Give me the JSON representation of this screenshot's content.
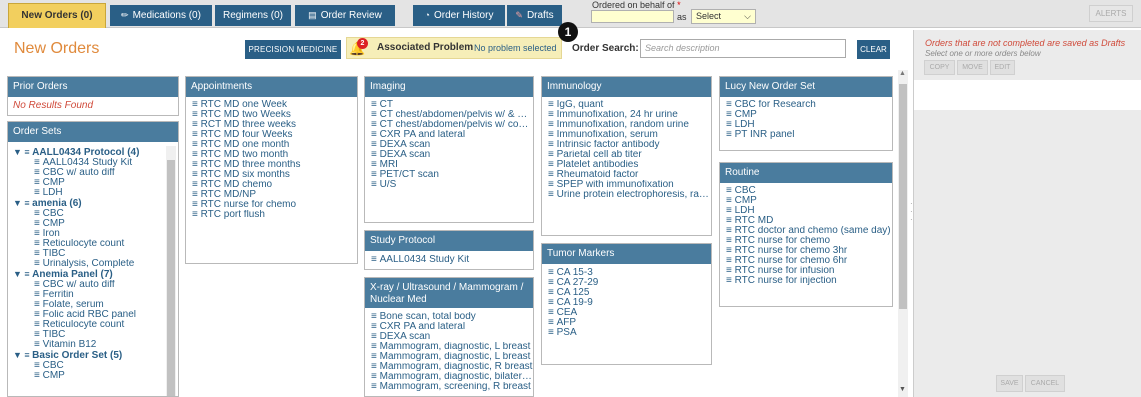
{
  "tabs": [
    {
      "label": "New Orders (0)",
      "active": true
    },
    {
      "label": "Medications (0)"
    },
    {
      "label": "Regimens (0)"
    },
    {
      "label": "Order Review"
    },
    {
      "label": "Order History"
    },
    {
      "label": "Drafts"
    }
  ],
  "behalf": {
    "label": "Ordered on behalf of",
    "required": "*",
    "as": "as",
    "select": "Select"
  },
  "alerts": "ALERTS",
  "title": "New Orders",
  "precision": "PRECISION MEDICINE",
  "assoc": {
    "badge": "2",
    "label": "Associated Problem",
    "value": "No problem selected"
  },
  "marker": "1",
  "search": {
    "label": "Order Search:",
    "placeholder": "Search description"
  },
  "clear": "CLEAR",
  "prior": {
    "title": "Prior Orders",
    "empty": "No Results Found"
  },
  "ordersets": {
    "title": "Order Sets",
    "sets": [
      {
        "name": "AALL0434 Protocol (4)",
        "items": [
          "AALL0434 Study Kit",
          "CBC w/ auto diff",
          "CMP",
          "LDH"
        ]
      },
      {
        "name": "amenia (6)",
        "items": [
          "CBC",
          "CMP",
          "Iron",
          "Reticulocyte count",
          "TIBC",
          "Urinalysis, Complete"
        ]
      },
      {
        "name": "Anemia Panel (7)",
        "items": [
          "CBC w/ auto diff",
          "Ferritin",
          "Folate, serum",
          "Folic acid RBC panel",
          "Reticulocyte count",
          "TIBC",
          "Vitamin B12"
        ]
      },
      {
        "name": "Basic Order Set (5)",
        "items": [
          "CBC",
          "CMP"
        ]
      }
    ]
  },
  "appointments": {
    "title": "Appointments",
    "items": [
      "RTC MD one Week",
      "RTC MD two Weeks",
      "RCT MD three weeks",
      "RTC MD four Weeks",
      "RTC MD one month",
      "RTC MD two month",
      "RTC MD three months",
      "RTC MD six months",
      "RTC MD chemo",
      "RTC MD/NP",
      "RTC nurse for chemo",
      "RTC port flush"
    ]
  },
  "imaging": {
    "title": "Imaging",
    "items": [
      "CT",
      "CT chest/abdomen/pelvis w/ & w/...",
      "CT chest/abdomen/pelvis w/ contr...",
      "CXR PA and lateral",
      "DEXA scan",
      "DEXA scan",
      "MRI",
      "PET/CT scan",
      "U/S"
    ]
  },
  "study": {
    "title": "Study Protocol",
    "items": [
      "AALL0434 Study Kit"
    ]
  },
  "xray": {
    "title": "X-ray / Ultrasound / Mammogram / Nuclear Med",
    "items": [
      "Bone scan, total body",
      "CXR PA and lateral",
      "DEXA scan",
      "Mammogram, diagnostic, L breast",
      "Mammogram, diagnostic, L breast",
      "Mammogram, diagnostic, R breast",
      "Mammogram, diagnostic, bilateral...",
      "Mammogram, screening, R breast"
    ]
  },
  "immunology": {
    "title": "Immunology",
    "items": [
      "IgG, quant",
      "Immunofixation, 24 hr urine",
      "Immunofixation, random urine",
      "Immunofixation, serum",
      "Intrinsic factor antibody",
      "Parietal cell ab titer",
      "Platelet antibodies",
      "Rheumatoid factor",
      "SPEP with immunofixation",
      "Urine protein electrophoresis, ran..."
    ]
  },
  "tumor": {
    "title": "Tumor Markers",
    "items": [
      "CA 15-3",
      "CA 27-29",
      "CA 125",
      "CA 19-9",
      "CEA",
      "AFP",
      "PSA"
    ]
  },
  "lucy": {
    "title": "Lucy New Order Set",
    "items": [
      "CBC for Research",
      "CMP",
      "LDH",
      "PT INR panel"
    ]
  },
  "routine": {
    "title": "Routine",
    "items": [
      "CBC",
      "CMP",
      "LDH",
      "RTC MD",
      "RTC doctor and chemo (same day)",
      "RTC nurse for chemo",
      "RTC nurse for chemo 3hr",
      "RTC nurse for chemo 6hr",
      "RTC nurse for infusion",
      "RTC nurse for injection"
    ]
  },
  "drafts": {
    "msg": "Orders that are not completed are saved as Drafts",
    "sub": "Select one or more orders below",
    "copy": "COPY",
    "move": "MOVE",
    "edit": "EDIT",
    "save": "SAVE",
    "cancel": "CANCEL"
  },
  "colors": {
    "accent": "#2a5f86",
    "header": "#4a7c9e",
    "title": "#e08a3c",
    "tab_active": "#f2cf5e"
  }
}
